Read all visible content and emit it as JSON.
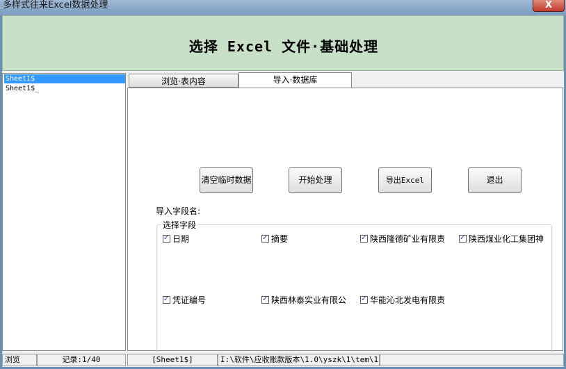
{
  "window": {
    "title": "多样式往来Excel数据处理",
    "close_glyph": "X"
  },
  "header": {
    "title": "选择 Excel 文件·基础处理"
  },
  "sidebar": {
    "items": [
      {
        "label": "Sheet1$",
        "selected": true
      },
      {
        "label": "Sheet1$_",
        "selected": false
      }
    ]
  },
  "tabs": [
    {
      "label": "浏览·表内容",
      "active": false
    },
    {
      "label": "导入·数据库",
      "active": true
    }
  ],
  "buttons": {
    "clear": "清空临时数据",
    "start": "开始处理",
    "export": "导出Excel",
    "exit": "退出"
  },
  "fields_label": "导入字段名:",
  "group": {
    "legend": "选择字段",
    "checkboxes": [
      {
        "label": "日期",
        "checked": true
      },
      {
        "label": "摘要",
        "checked": true
      },
      {
        "label": "陕西隆德矿业有限责",
        "checked": true
      },
      {
        "label": "陕西煤业化工集团神",
        "checked": true
      },
      {
        "label": "凭证编号",
        "checked": true
      },
      {
        "label": "陕西林泰实业有限公",
        "checked": true
      },
      {
        "label": "华能沁北发电有限责",
        "checked": true
      }
    ]
  },
  "status": {
    "mode": "浏览",
    "record": "记录:1/40",
    "sheet": "[Sheet1$]",
    "path": "I:\\软件\\应收账款版本\\1.0\\yszk\\1\\tem\\1("
  },
  "colors": {
    "header_bg": "#c8dfc8",
    "selection": "#3399ff"
  }
}
